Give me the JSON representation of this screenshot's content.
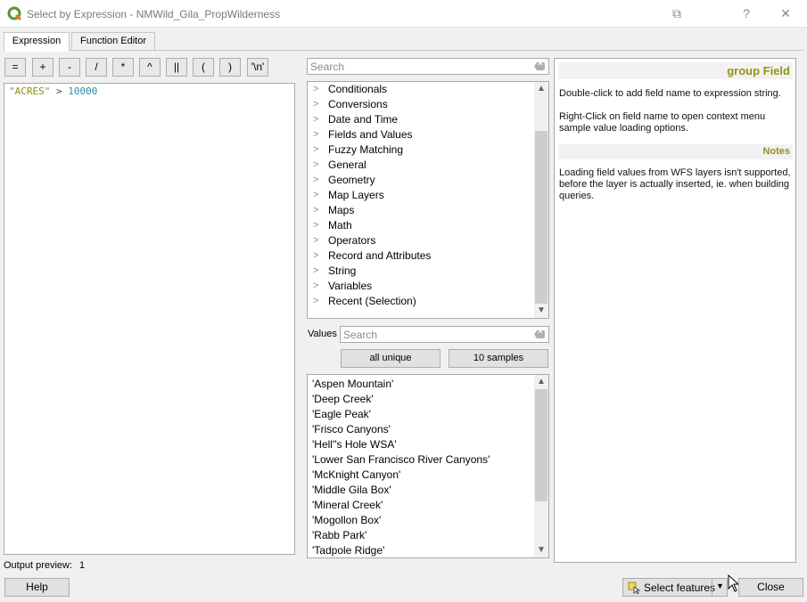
{
  "window": {
    "title": "Select by Expression - NMWild_Gila_PropWilderness",
    "buttons": {
      "restore": "⧉",
      "help": "?",
      "close": "✕"
    }
  },
  "tabs": [
    "Expression",
    "Function Editor"
  ],
  "operators": [
    "=",
    "+",
    "-",
    "/",
    "*",
    "^",
    "||",
    "(",
    ")",
    "'\\n'"
  ],
  "expression": {
    "field": "\"ACRES\"",
    "operator": ">",
    "number": "10000"
  },
  "function_search": {
    "placeholder": "Search"
  },
  "function_groups": [
    "Conditionals",
    "Conversions",
    "Date and Time",
    "Fields and Values",
    "Fuzzy Matching",
    "General",
    "Geometry",
    "Map Layers",
    "Maps",
    "Math",
    "Operators",
    "Record and Attributes",
    "String",
    "Variables",
    "Recent (Selection)"
  ],
  "values": {
    "label": "Values",
    "search_placeholder": "Search",
    "all_unique_label": "all unique",
    "samples_label": "10 samples",
    "items": [
      "'Aspen Mountain'",
      "'Deep Creek'",
      "'Eagle Peak'",
      "'Frisco Canyons'",
      "'Hell''s Hole WSA'",
      "'Lower San Francisco River Canyons'",
      "'McKnight Canyon'",
      "'Middle Gila Box'",
      "'Mineral Creek'",
      "'Mogollon Box'",
      "'Rabb Park'",
      "'Tadpole Ridge'"
    ]
  },
  "help": {
    "title": "group Field",
    "body1": "Double-click to add field name to expression string.",
    "body2": "Right-Click on field name to open context menu sample value loading options.",
    "notes_title": "Notes",
    "notes_body": "Loading field values from WFS layers isn't supported, before the layer is actually inserted, ie. when building queries."
  },
  "output_preview": {
    "label": "Output preview:",
    "value": "1"
  },
  "footer": {
    "help": "Help",
    "select_features": "Select features",
    "close": "Close"
  },
  "colors": {
    "accent": "#93931a",
    "number": "#2a8eaa",
    "qgis_green": "#589632"
  }
}
